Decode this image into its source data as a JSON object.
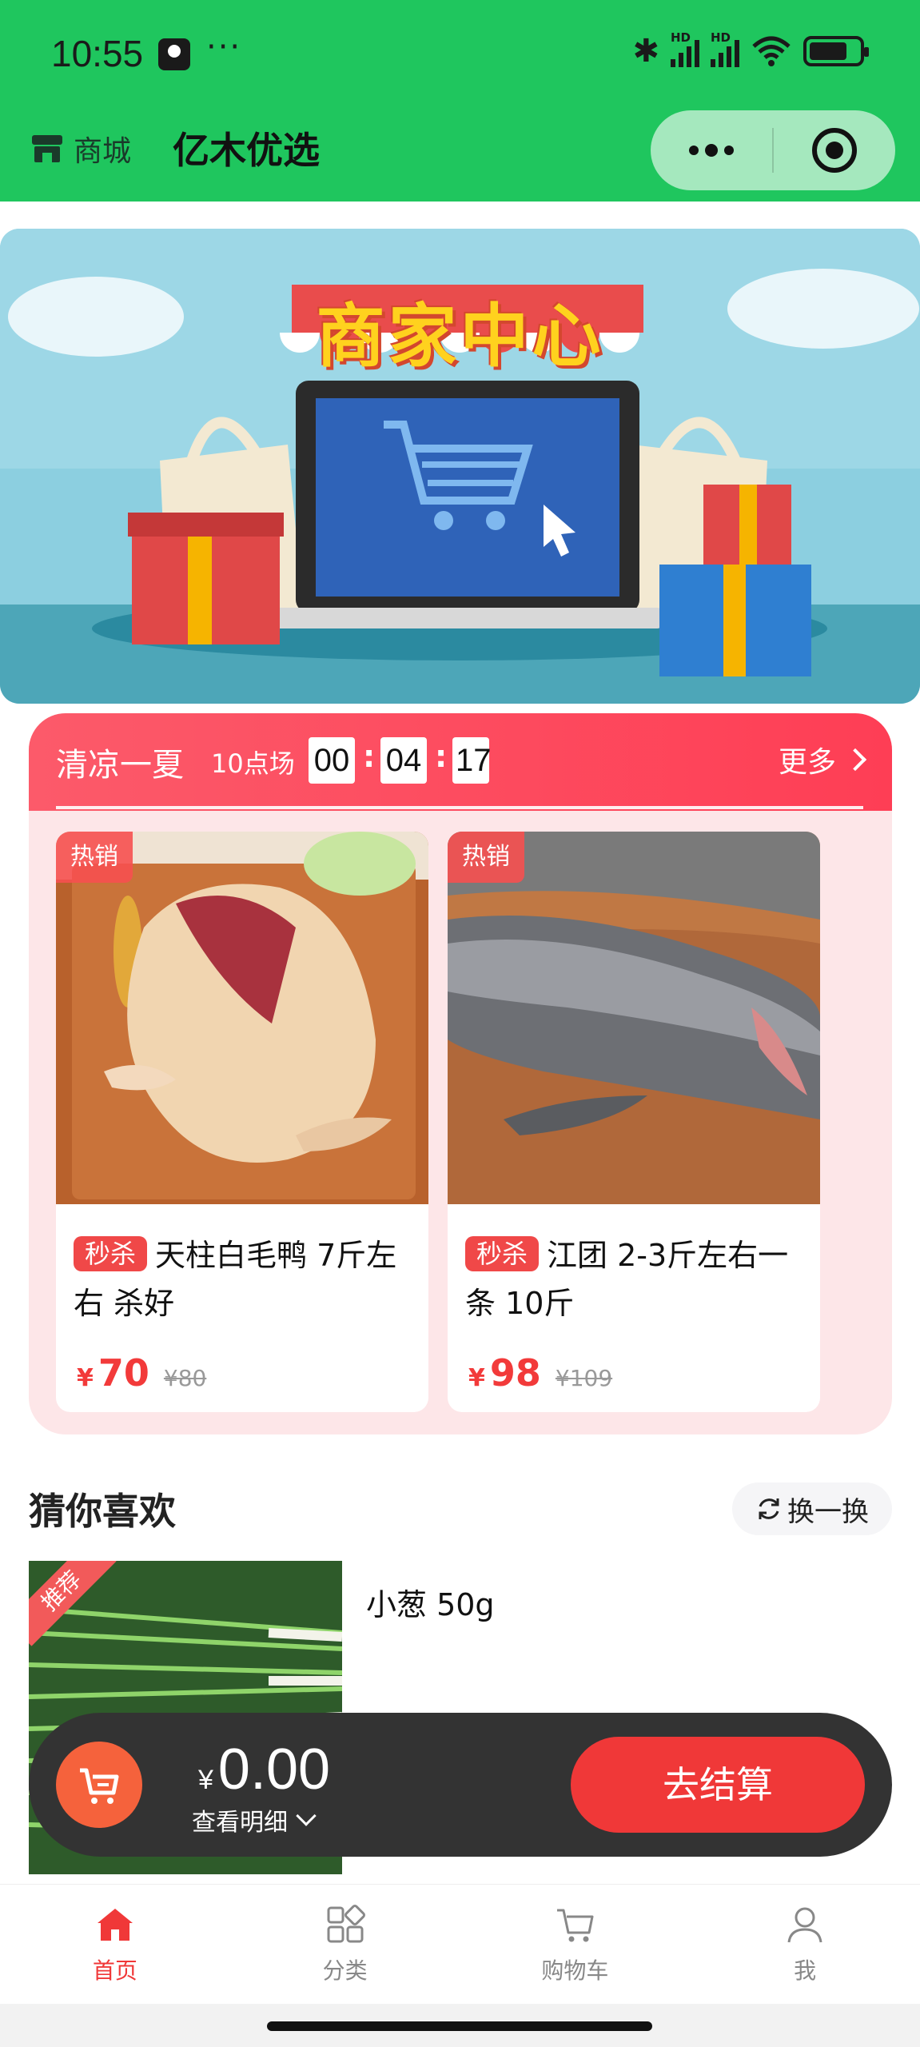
{
  "status_bar": {
    "time": "10:55",
    "extra": "···"
  },
  "nav": {
    "shop_label": "商城",
    "title": "亿木优选"
  },
  "banner": {
    "title": "商家中心"
  },
  "flash_sale": {
    "title": "清凉一夏",
    "session": "10点场",
    "countdown": {
      "hours": "00",
      "minutes": "04",
      "seconds": "17"
    },
    "separator": ":",
    "more_label": "更多",
    "products": [
      {
        "tag": "热销",
        "badge": "秒杀",
        "name": "天柱白毛鸭 7斤左右 杀好",
        "currency": "¥",
        "price": "70",
        "original_price": "¥80"
      },
      {
        "tag": "热销",
        "badge": "秒杀",
        "name": "江团 2-3斤左右一条 10斤",
        "currency": "¥",
        "price": "98",
        "original_price": "¥109"
      }
    ]
  },
  "guess_you_like": {
    "title": "猜你喜欢",
    "refresh_label": "换一换",
    "items": [
      {
        "tag": "推荐",
        "name": "小葱 50g"
      }
    ]
  },
  "cart_bar": {
    "currency": "¥",
    "amount": "0.00",
    "detail_label": "查看明细",
    "checkout_label": "去结算"
  },
  "tab_bar": {
    "tabs": [
      {
        "label": "首页",
        "icon": "home-icon",
        "active": true
      },
      {
        "label": "分类",
        "icon": "category-icon",
        "active": false
      },
      {
        "label": "购物车",
        "icon": "cart-icon",
        "active": false
      },
      {
        "label": "我",
        "icon": "user-icon",
        "active": false
      }
    ]
  },
  "colors": {
    "brand_green": "#1fc65e",
    "accent_red": "#f03838",
    "sale_pink": "#fde6e8"
  }
}
